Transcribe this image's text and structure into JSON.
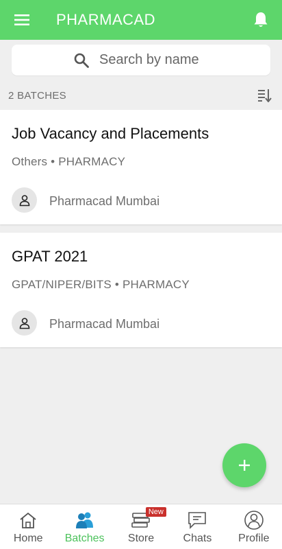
{
  "app": {
    "title": "PHARMACAD"
  },
  "search": {
    "placeholder": "Search by name"
  },
  "batches": {
    "count_label": "2 BATCHES",
    "items": [
      {
        "title": "Job Vacancy and Placements",
        "subtitle": "Others • PHARMACY",
        "owner": "Pharmacad Mumbai"
      },
      {
        "title": "GPAT 2021",
        "subtitle": "GPAT/NIPER/BITS • PHARMACY",
        "owner": "Pharmacad Mumbai"
      }
    ]
  },
  "nav": {
    "items": [
      {
        "label": "Home",
        "icon": "home-icon",
        "active": false
      },
      {
        "label": "Batches",
        "icon": "batches-icon",
        "active": true
      },
      {
        "label": "Store",
        "icon": "store-icon",
        "active": false,
        "badge": "New"
      },
      {
        "label": "Chats",
        "icon": "chat-icon",
        "active": false
      },
      {
        "label": "Profile",
        "icon": "profile-icon",
        "active": false
      }
    ]
  },
  "colors": {
    "primary": "#5dd66b",
    "active_label": "#4cc25c",
    "badge": "#c9302c",
    "background": "#efefef"
  }
}
